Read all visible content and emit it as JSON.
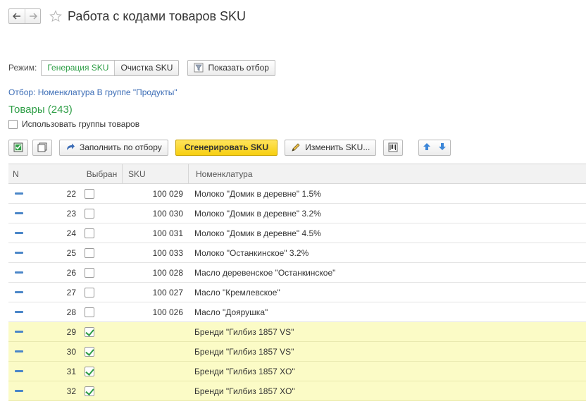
{
  "window": {
    "title": "Работа с кодами товаров SKU"
  },
  "mode": {
    "label": "Режим:",
    "options": [
      "Генерация SKU",
      "Очистка SKU"
    ],
    "selected": "Генерация SKU",
    "show_filter_label": "Показать отбор"
  },
  "filter": {
    "text": "Отбор:  Номенклатура В группе \"Продукты\""
  },
  "products": {
    "title": "Товары (243)",
    "use_groups_label": "Использовать группы товаров"
  },
  "toolbar": {
    "fill_label": "Заполнить по отбору",
    "generate_label": "Сгенерировать SKU",
    "change_label": "Изменить SKU..."
  },
  "table": {
    "columns": [
      "N",
      "Выбран",
      "SKU",
      "Номенклатура"
    ],
    "rows": [
      {
        "n": "22",
        "selected": false,
        "sku": "100 029",
        "name": "Молоко \"Домик в деревне\" 1.5%"
      },
      {
        "n": "23",
        "selected": false,
        "sku": "100 030",
        "name": "Молоко \"Домик в деревне\" 3.2%"
      },
      {
        "n": "24",
        "selected": false,
        "sku": "100 031",
        "name": "Молоко \"Домик в деревне\" 4.5%"
      },
      {
        "n": "25",
        "selected": false,
        "sku": "100 033",
        "name": "Молоко \"Останкинское\" 3.2%"
      },
      {
        "n": "26",
        "selected": false,
        "sku": "100 028",
        "name": "Масло деревенское \"Останкинское\""
      },
      {
        "n": "27",
        "selected": false,
        "sku": "100 027",
        "name": "Масло \"Кремлевское\""
      },
      {
        "n": "28",
        "selected": false,
        "sku": "100 026",
        "name": "Масло \"Доярушка\""
      },
      {
        "n": "29",
        "selected": true,
        "sku": "",
        "name": "Бренди \"Гилбиз 1857 VS\""
      },
      {
        "n": "30",
        "selected": true,
        "sku": "",
        "name": "Бренди \"Гилбиз 1857 VS\""
      },
      {
        "n": "31",
        "selected": true,
        "sku": "",
        "name": "Бренди  \"Гилбиз 1857 XO\""
      },
      {
        "n": "32",
        "selected": true,
        "sku": "",
        "name": "Бренди  \"Гилбиз 1857 XO\""
      }
    ]
  },
  "colors": {
    "accent_green": "#2e9e46",
    "link_blue": "#3c6db6",
    "selected_row": "#fbfbc6",
    "primary_button": "#f7cf10"
  }
}
